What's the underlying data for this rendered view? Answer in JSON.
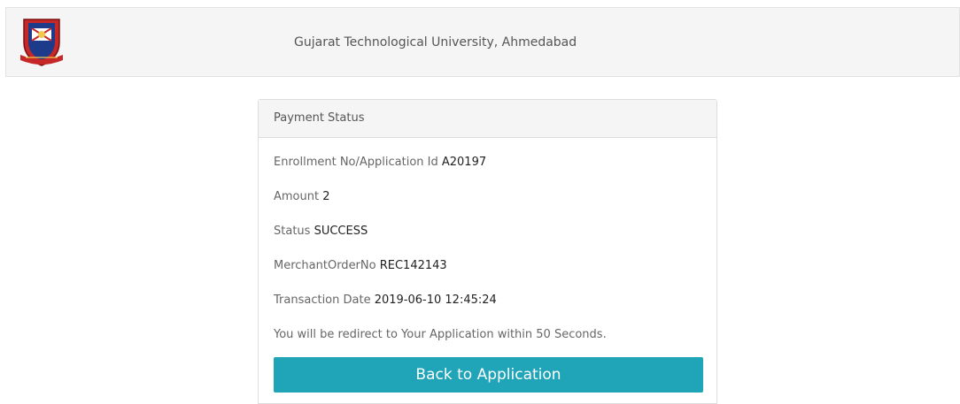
{
  "header": {
    "title": "Gujarat Technological University, Ahmedabad",
    "logo_icon": "university-crest-logo"
  },
  "panel": {
    "heading": "Payment Status",
    "fields": [
      {
        "label": "Enrollment No/Application Id",
        "value": "A20197"
      },
      {
        "label": "Amount",
        "value": "2"
      },
      {
        "label": "Status",
        "value": "SUCCESS"
      },
      {
        "label": "MerchantOrderNo",
        "value": "REC142143"
      },
      {
        "label": "Transaction Date",
        "value": "2019-06-10 12:45:24"
      }
    ],
    "redirect_note": "You will be redirect to Your Application within 50 Seconds.",
    "back_button_label": "Back to Application"
  },
  "colors": {
    "button": "#1fa4b8",
    "header_bg": "#f5f5f5",
    "crest_red": "#c62828",
    "crest_blue": "#1e3a8a"
  }
}
